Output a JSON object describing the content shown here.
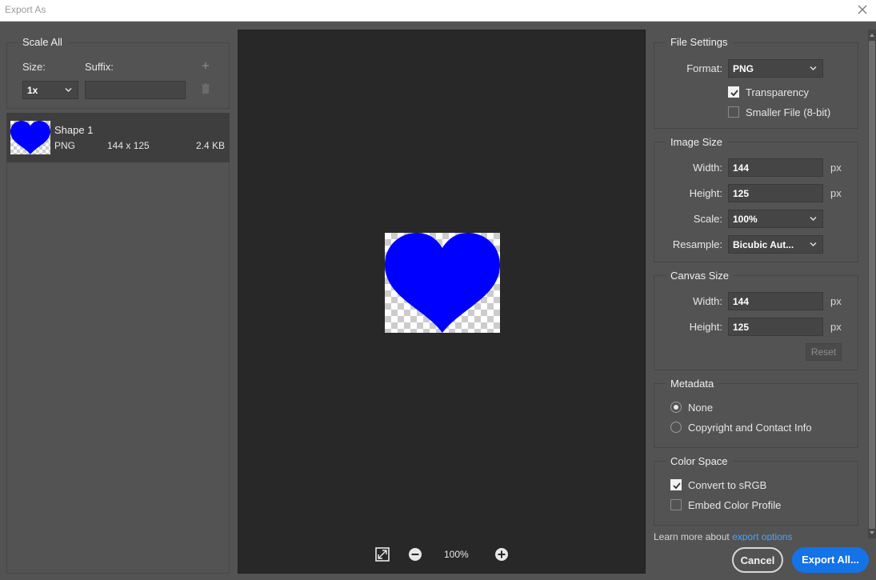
{
  "window": {
    "title": "Export As"
  },
  "left": {
    "group_label": "Scale All",
    "size_label": "Size:",
    "suffix_label": "Suffix:",
    "size_value": "1x",
    "suffix_value": "",
    "add_icon": "plus-icon",
    "delete_icon": "trash-icon",
    "asset": {
      "name": "Shape 1",
      "format": "PNG",
      "dimensions": "144 x 125",
      "filesize": "2.4 KB",
      "color": "#0000ff"
    }
  },
  "preview": {
    "zoom": "100%",
    "shape_color": "#0000ff",
    "icons": [
      "fit-icon",
      "zoom-out-icon",
      "zoom-in-icon"
    ]
  },
  "file_settings": {
    "label": "File Settings",
    "format_label": "Format:",
    "format_value": "PNG",
    "transparency_label": "Transparency",
    "transparency_checked": true,
    "smaller_file_label": "Smaller File (8-bit)",
    "smaller_file_checked": false
  },
  "image_size": {
    "label": "Image Size",
    "width_label": "Width:",
    "width_value": "144",
    "height_label": "Height:",
    "height_value": "125",
    "scale_label": "Scale:",
    "scale_value": "100%",
    "resample_label": "Resample:",
    "resample_value": "Bicubic Aut...",
    "unit": "px"
  },
  "canvas_size": {
    "label": "Canvas Size",
    "width_label": "Width:",
    "width_value": "144",
    "height_label": "Height:",
    "height_value": "125",
    "unit": "px",
    "reset_label": "Reset"
  },
  "metadata": {
    "label": "Metadata",
    "options": [
      "None",
      "Copyright and Contact Info"
    ],
    "selected": "None"
  },
  "color_space": {
    "label": "Color Space",
    "convert_label": "Convert to sRGB",
    "convert_checked": true,
    "embed_label": "Embed Color Profile",
    "embed_checked": false
  },
  "footer": {
    "learn_text": "Learn more about",
    "learn_link": "export options",
    "cancel_label": "Cancel",
    "export_label": "Export All..."
  },
  "colors": {
    "accent": "#1473e6",
    "link": "#4aa3ff",
    "panel_bg": "#535353",
    "preview_bg": "#282828"
  }
}
